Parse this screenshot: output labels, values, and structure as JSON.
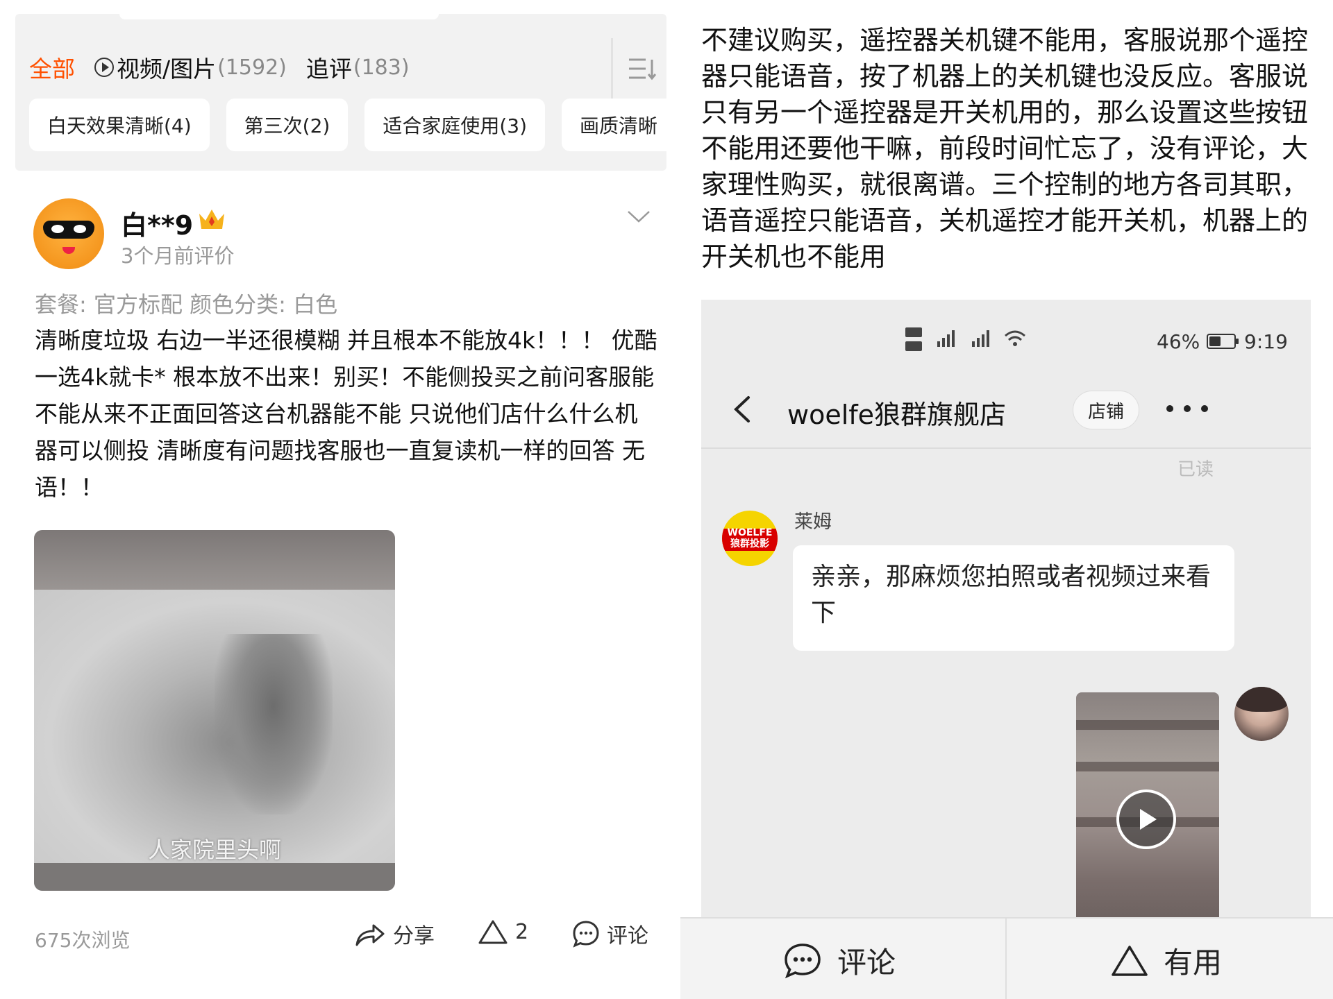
{
  "left": {
    "filter_tabs": [
      {
        "label": "全部",
        "count": ""
      },
      {
        "label": "视频/图片",
        "count": "(1592)"
      },
      {
        "label": "追评",
        "count": "(183)"
      }
    ],
    "chips": [
      "白天效果清晰(4)",
      "第三次(2)",
      "适合家庭使用(3)",
      "画质清晰"
    ],
    "review": {
      "username": "白**9",
      "time": "3个月前评价",
      "spec": "套餐: 官方标配  颜色分类: 白色",
      "text": "清晰度垃圾 右边一半还很模糊 并且根本不能放4k！！！ 优酷一选4k就卡* 根本放不出来！别买！不能侧投买之前问客服能不能从来不正面回答这台机器能不能 只说他们店什么什么机器可以侧投 清晰度有问题找客服也一直复读机一样的回答 无语！！",
      "video_caption": "人家院里头啊",
      "views": "675次浏览",
      "share_label": "分享",
      "like_count": "2",
      "comment_label": "评论"
    }
  },
  "right": {
    "review_text": "不建议购买，遥控器关机键不能用，客服说那个遥控器只能语音，按了机器上的关机键也没反应。客服说只有另一个遥控器是开关机用的，那么设置这些按钮不能用还要他干嘛，前段时间忙忘了，没有评论，大家理性购买，就很离谱。三个控制的地方各司其职，语音遥控只能语音，关机遥控才能开关机，机器上的开关机也不能用",
    "phone": {
      "status": {
        "battery": "46%",
        "time": "9:19"
      },
      "shop_name": "woelfe狼群旗舰店",
      "shop_button": "店铺",
      "read_label": "已读",
      "sender_name": "莱姆",
      "shop_logo_text": "WOELFE 狼群投影",
      "message": "亲亲，那麻烦您拍照或者视频过来看下"
    },
    "bottom_bar": {
      "comment_label": "评论",
      "useful_label": "有用"
    }
  },
  "colors": {
    "accent": "#ff5000",
    "muted": "#999999",
    "chip_bg": "#ffffff",
    "panel_bg": "#f2f2f2",
    "chat_bg": "#ececec"
  }
}
